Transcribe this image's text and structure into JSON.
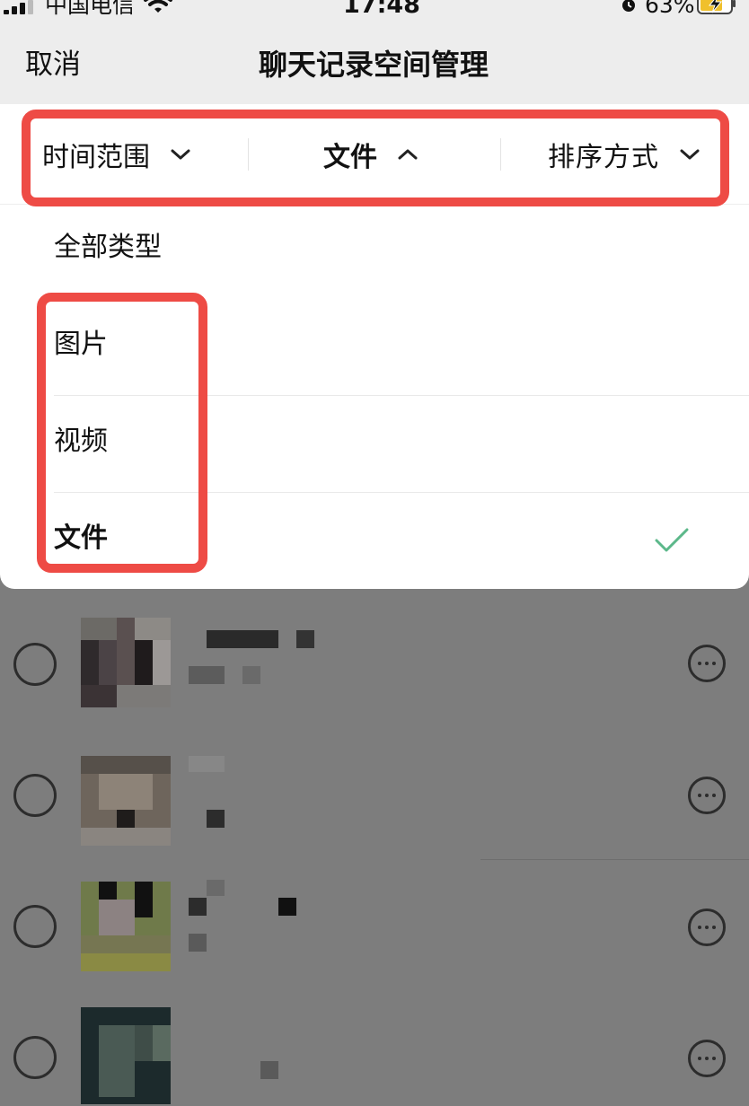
{
  "status_bar": {
    "carrier": "中国电信",
    "time": "17:48",
    "battery_percent": "63%"
  },
  "nav": {
    "cancel_label": "取消",
    "title": "聊天记录空间管理"
  },
  "filters": {
    "time_range": "时间范围",
    "type": "文件",
    "sort": "排序方式"
  },
  "type_options": [
    {
      "label": "全部类型",
      "selected": false
    },
    {
      "label": "图片",
      "selected": false
    },
    {
      "label": "视频",
      "selected": false
    },
    {
      "label": "文件",
      "selected": true
    }
  ],
  "colors": {
    "highlight": "#ee4b45",
    "check": "#5cb88a"
  },
  "icons": {
    "signal": "signal-icon",
    "wifi": "wifi-icon",
    "alarm": "alarm-icon",
    "battery": "battery-charging-icon",
    "chevron_down": "chevron-down-icon",
    "chevron_up": "chevron-up-icon",
    "check": "check-icon",
    "more": "more-icon"
  }
}
